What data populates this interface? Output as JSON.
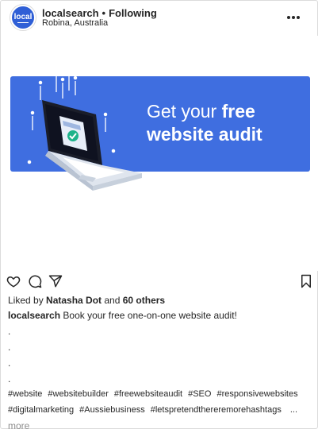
{
  "header": {
    "avatar_text": "local",
    "username": "localsearch",
    "separator": "•",
    "follow_status": "Following",
    "location": "Robina, Australia"
  },
  "banner": {
    "text_line1_prefix": "Get your ",
    "text_line1_bold": "free",
    "text_line2": "website audit",
    "background": "#3f6ee0"
  },
  "actions": {
    "icons": [
      "heart-icon",
      "comment-icon",
      "share-icon",
      "bookmark-icon"
    ]
  },
  "likes": {
    "prefix": "Liked by ",
    "user": "Natasha Dot",
    "middle": " and ",
    "others": "60 others"
  },
  "caption": {
    "username": "localsearch",
    "text": "Book your free one-on-one website audit!"
  },
  "dots": [
    ".",
    ".",
    ".",
    "."
  ],
  "hashtags": {
    "line1": [
      "#website",
      "#websitebuilder",
      "#freewebsiteaudit",
      "#SEO",
      "#responsivewebsites"
    ],
    "line2": [
      "#digitalmarketing",
      "#Aussiebusiness",
      "#letspretendthereremorehashtags"
    ],
    "ellipsis": "..."
  },
  "more_label": "more"
}
